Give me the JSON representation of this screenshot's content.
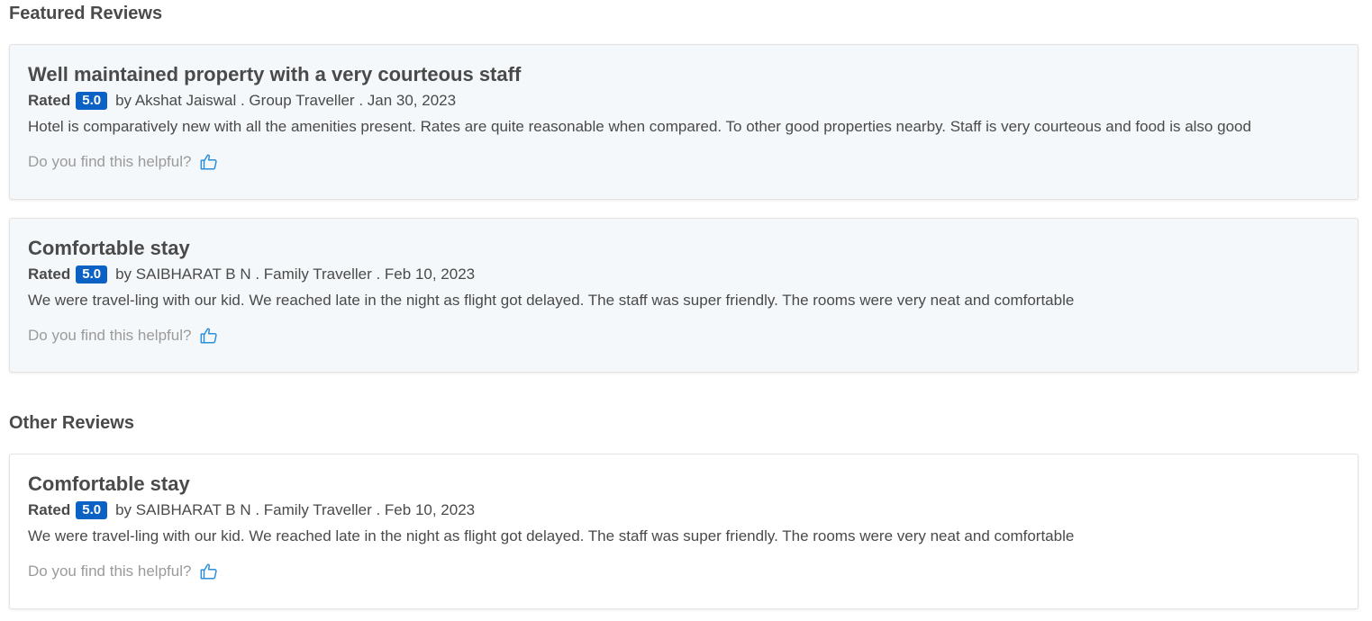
{
  "featured": {
    "heading": "Featured Reviews",
    "reviews": [
      {
        "title": "Well maintained property with a very courteous staff",
        "rated_label": "Rated",
        "rating": "5.0",
        "author_line": "by Akshat Jaiswal . Group Traveller . Jan 30, 2023",
        "body": "Hotel is comparatively new with all the amenities present. Rates are quite reasonable when compared. To other good properties nearby. Staff is very courteous and food is also good",
        "helpful_prompt": "Do you find this helpful?",
        "helpful_icon": "thumbs-up-icon"
      },
      {
        "title": "Comfortable stay",
        "rated_label": "Rated",
        "rating": "5.0",
        "author_line": "by SAIBHARAT B N . Family Traveller . Feb 10, 2023",
        "body": "We were travel-ling with our kid. We reached late in the night as flight got delayed. The staff was super friendly. The rooms were very neat and comfortable",
        "helpful_prompt": "Do you find this helpful?",
        "helpful_icon": "thumbs-up-icon"
      }
    ]
  },
  "other": {
    "heading": "Other Reviews",
    "reviews": [
      {
        "title": "Comfortable stay",
        "rated_label": "Rated",
        "rating": "5.0",
        "author_line": "by SAIBHARAT B N . Family Traveller . Feb 10, 2023",
        "body": "We were travel-ling with our kid. We reached late in the night as flight got delayed. The staff was super friendly. The rooms were very neat and comfortable",
        "helpful_prompt": "Do you find this helpful?",
        "helpful_icon": "thumbs-up-icon"
      }
    ]
  },
  "colors": {
    "rating_badge": "#0b61c4",
    "icon_blue": "#2a8fdc",
    "featured_bg": "#f4f8fa"
  }
}
